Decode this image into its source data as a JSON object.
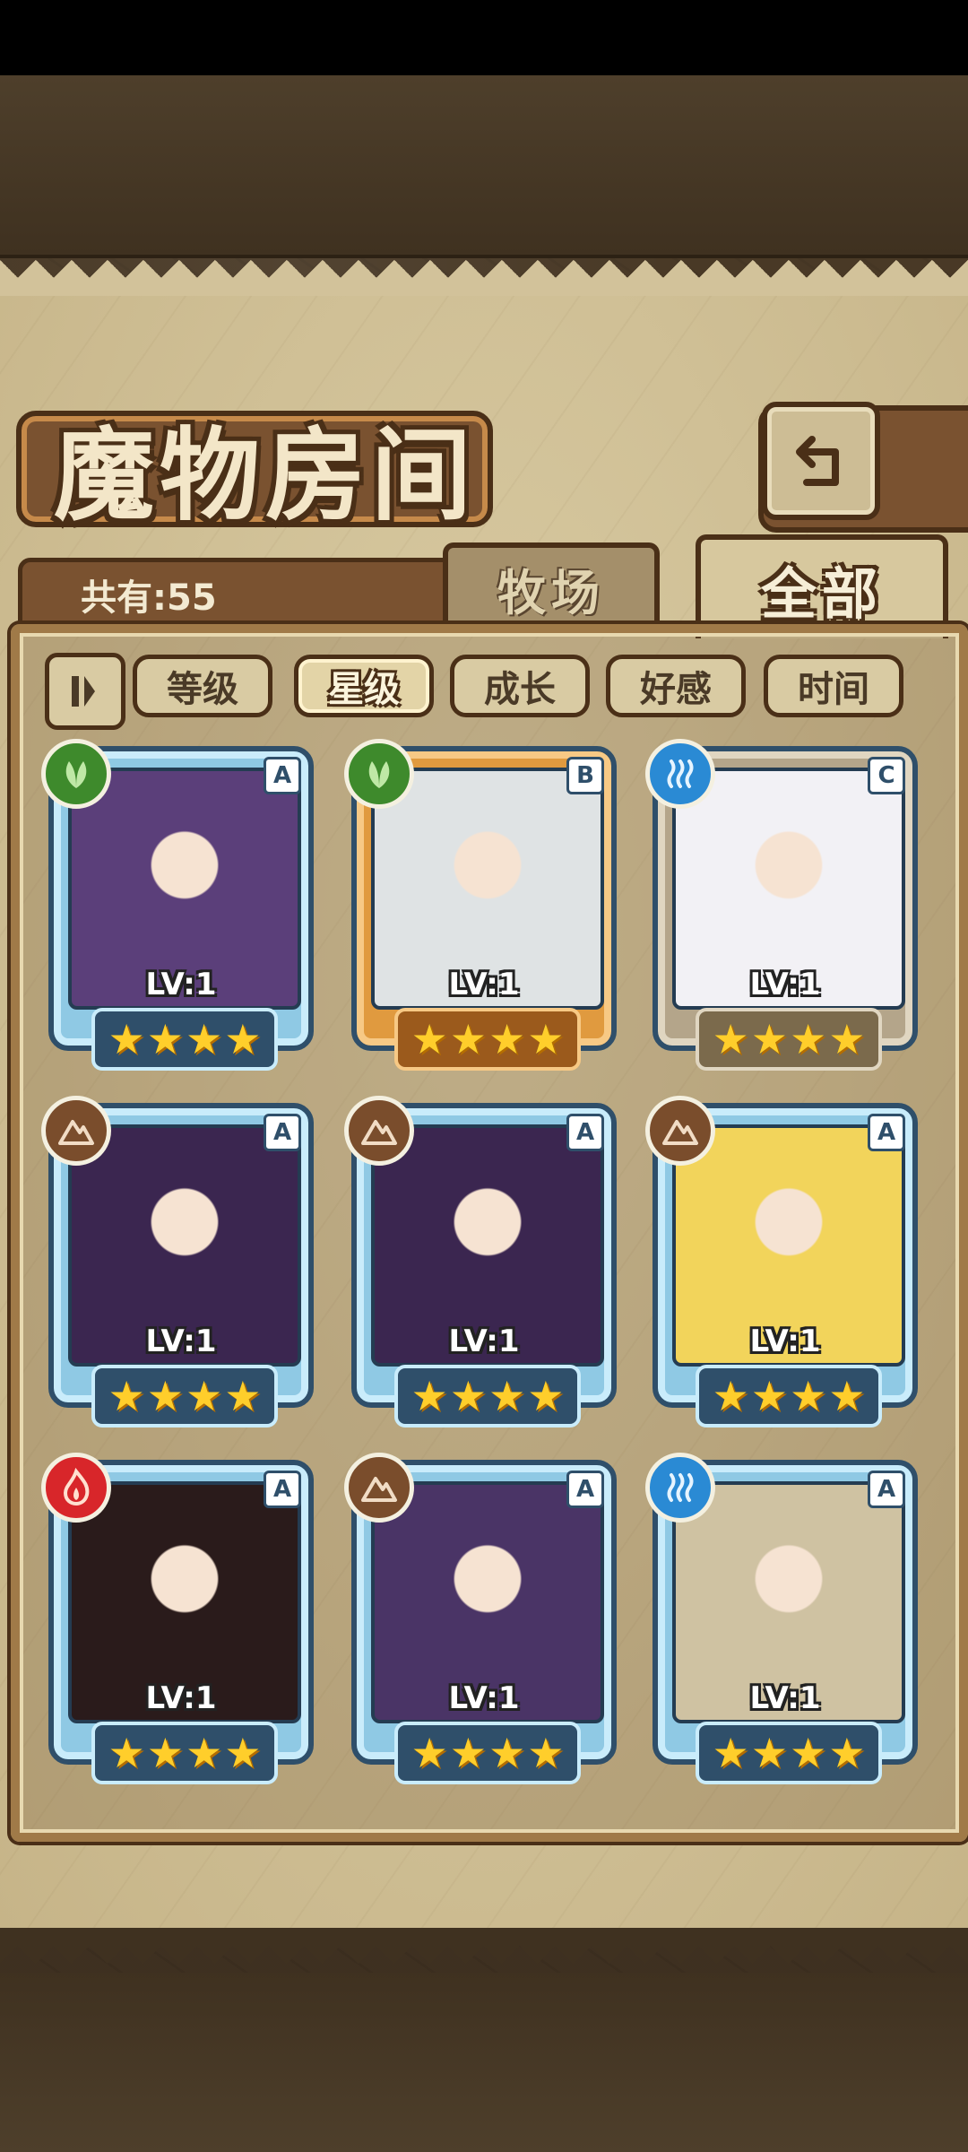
{
  "header": {
    "title": "魔物房间",
    "back_icon": "return-arrow-icon"
  },
  "summary": {
    "total_label": "共有:55"
  },
  "tabs": [
    {
      "label": "牧场",
      "active": false
    },
    {
      "label": "全部",
      "active": true
    }
  ],
  "sort": {
    "toggle_icon": "sort-order-icon",
    "options": [
      {
        "label": "等级",
        "active": false
      },
      {
        "label": "星级",
        "active": true
      },
      {
        "label": "成长",
        "active": false
      },
      {
        "label": "好感",
        "active": false
      },
      {
        "label": "时间",
        "active": false
      }
    ]
  },
  "monsters": [
    {
      "element": "nature",
      "rank": "A",
      "level": "LV:1",
      "stars": 4,
      "portrait_color": "#5b3f7a"
    },
    {
      "element": "nature",
      "rank": "B",
      "level": "LV:1",
      "stars": 4,
      "portrait_color": "#dfe3e4"
    },
    {
      "element": "water",
      "rank": "C",
      "level": "LV:1",
      "stars": 4,
      "portrait_color": "#f2f1f5"
    },
    {
      "element": "earth",
      "rank": "A",
      "level": "LV:1",
      "stars": 4,
      "portrait_color": "#3b2650"
    },
    {
      "element": "earth",
      "rank": "A",
      "level": "LV:1",
      "stars": 4,
      "portrait_color": "#3b2650"
    },
    {
      "element": "earth",
      "rank": "A",
      "level": "LV:1",
      "stars": 4,
      "portrait_color": "#f2d45b"
    },
    {
      "element": "fire",
      "rank": "A",
      "level": "LV:1",
      "stars": 4,
      "portrait_color": "#2a1b1b"
    },
    {
      "element": "earth",
      "rank": "A",
      "level": "LV:1",
      "stars": 4,
      "portrait_color": "#4a3466"
    },
    {
      "element": "water",
      "rank": "A",
      "level": "LV:1",
      "stars": 4,
      "portrait_color": "#cfc2a2"
    }
  ],
  "colors": {
    "nature": "#3e8a2c",
    "water": "#2a8ad4",
    "earth": "#7a4d2c",
    "fire": "#d8262a",
    "star": "#ffce2b"
  }
}
